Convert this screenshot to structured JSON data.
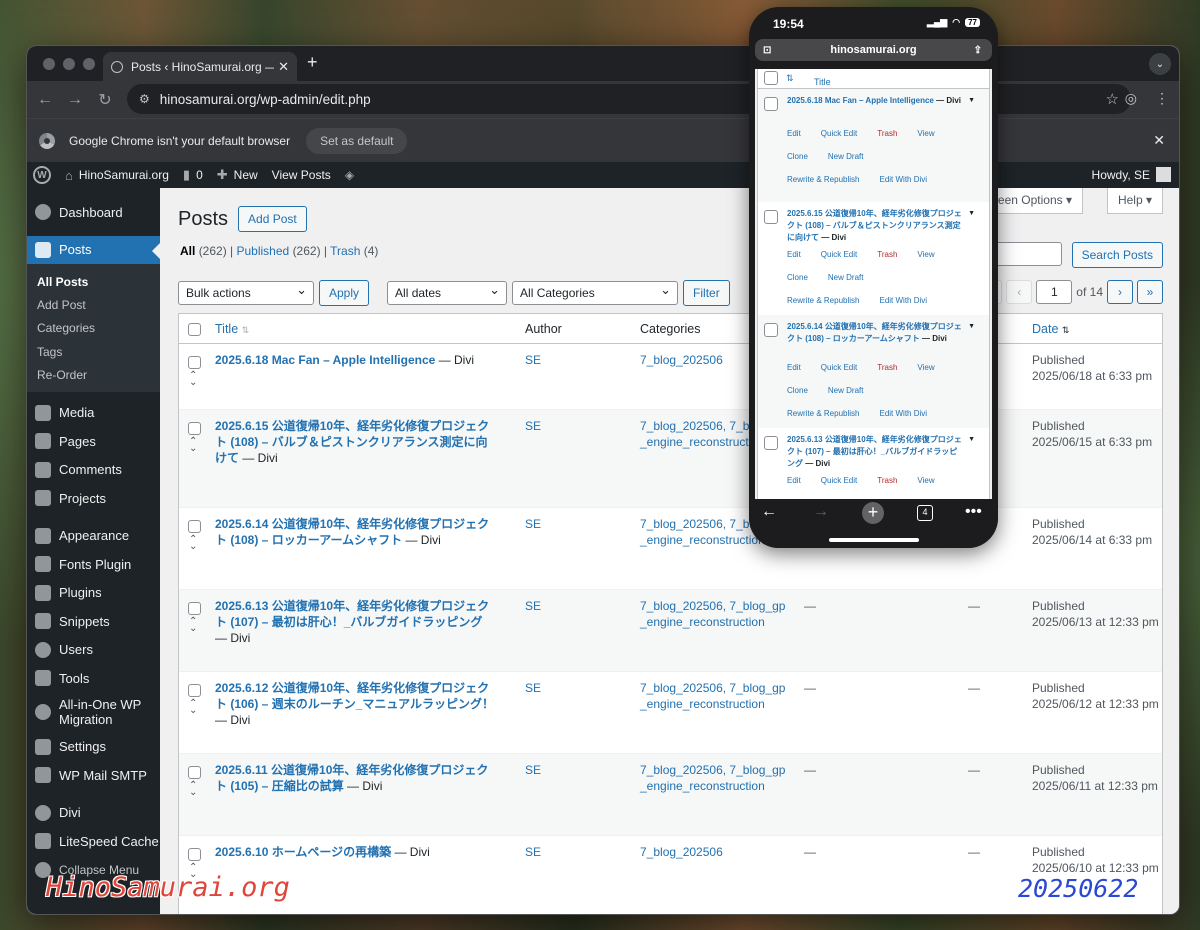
{
  "browser": {
    "tab_title": "Posts ‹ HinoSamurai.org — W",
    "url": "hinosamurai.org/wp-admin/edit.php",
    "infobar_text": "Google Chrome isn't your default browser",
    "set_default_label": "Set as default"
  },
  "adminbar": {
    "site_name": "HinoSamurai.org",
    "comments_count": "0",
    "new_label": "New",
    "view_posts_label": "View Posts",
    "howdy": "Howdy, SE"
  },
  "sidebar": {
    "dashboard": "Dashboard",
    "posts": "Posts",
    "submenu": [
      "All Posts",
      "Add Post",
      "Categories",
      "Tags",
      "Re-Order"
    ],
    "items": [
      "Media",
      "Pages",
      "Comments",
      "Projects",
      "Appearance",
      "Fonts Plugin",
      "Plugins",
      "Snippets",
      "Users",
      "Tools",
      "All-in-One WP Migration",
      "Settings",
      "WP Mail SMTP",
      "Divi",
      "LiteSpeed Cache",
      "Collapse Menu"
    ]
  },
  "page": {
    "title": "Posts",
    "add_post": "Add Post",
    "screen_options": "Screen Options",
    "help": "Help",
    "filters": {
      "all": "All",
      "all_count": "(262)",
      "published": "Published",
      "published_count": "(262)",
      "trash": "Trash",
      "trash_count": "(4)"
    },
    "search_button": "Search Posts",
    "bulk_actions": "Bulk actions",
    "apply": "Apply",
    "all_dates": "All dates",
    "all_categories": "All Categories",
    "filter": "Filter",
    "pagination": {
      "first": "«",
      "prev": "‹",
      "current": "1",
      "of_text": "of 14",
      "next": "›",
      "last": "»"
    }
  },
  "table": {
    "columns": {
      "title": "Title",
      "author": "Author",
      "categories": "Categories",
      "date": "Date"
    },
    "rows": [
      {
        "title": "2025.6.18 Mac Fan – Apple Intelligence",
        "suffix": " — Divi",
        "author": "SE",
        "categories": "7_blog_202506",
        "tags": "",
        "comments": "",
        "status": "Published",
        "date": "2025/06/18 at 6:33 pm"
      },
      {
        "title": "2025.6.15 公道復帰10年、経年劣化修復プロジェクト (108) – バルブ＆ピストンクリアランス測定に向けて",
        "suffix": " — Divi",
        "author": "SE",
        "categories": "7_blog_202506, 7_blog_gp_engine_reconstruction",
        "tags": "",
        "comments": "",
        "status": "Published",
        "date": "2025/06/15 at 6:33 pm"
      },
      {
        "title": "2025.6.14 公道復帰10年、経年劣化修復プロジェクト (108) – ロッカーアームシャフト",
        "suffix": " — Divi",
        "author": "SE",
        "categories": "7_blog_202506, 7_blog_gp_engine_reconstruction",
        "tags": "",
        "comments": "",
        "status": "Published",
        "date": "2025/06/14 at 6:33 pm"
      },
      {
        "title": "2025.6.13 公道復帰10年、経年劣化修復プロジェクト (107) – 最初は肝心！_バルブガイドラッピング",
        "suffix": " — Divi",
        "author": "SE",
        "categories": "7_blog_202506, 7_blog_gp_engine_reconstruction",
        "tags": "—",
        "comments": "—",
        "status": "Published",
        "date": "2025/06/13 at 12:33 pm"
      },
      {
        "title": "2025.6.12 公道復帰10年、経年劣化修復プロジェクト (106) – 週末のルーチン_マニュアルラッピング！",
        "suffix": " — Divi",
        "author": "SE",
        "categories": "7_blog_202506, 7_blog_gp_engine_reconstruction",
        "tags": "—",
        "comments": "—",
        "status": "Published",
        "date": "2025/06/12 at 12:33 pm"
      },
      {
        "title": "2025.6.11 公道復帰10年、経年劣化修復プロジェクト (105) – 圧縮比の試算",
        "suffix": " — Divi",
        "author": "SE",
        "categories": "7_blog_202506, 7_blog_gp_engine_reconstruction",
        "tags": "—",
        "comments": "—",
        "status": "Published",
        "date": "2025/06/11 at 12:33 pm"
      },
      {
        "title": "2025.6.10 ホームページの再構築",
        "suffix": " — Divi",
        "author": "SE",
        "categories": "7_blog_202506",
        "tags": "—",
        "comments": "—",
        "status": "Published",
        "date": "2025/06/10 at 12:33 pm"
      }
    ]
  },
  "phone": {
    "time": "19:54",
    "battery": "77",
    "url": "hinosamurai.org",
    "title_header": "Title",
    "tabs_count": "4",
    "rows": [
      {
        "title": "2025.6.18 Mac Fan – Apple Intelligence",
        "suffix": " — Divi"
      },
      {
        "title": "2025.6.15 公道復帰10年、経年劣化修復プロジェクト (108) – バルブ＆ピストンクリアランス測定に向けて",
        "suffix": " — Divi"
      },
      {
        "title": "2025.6.14 公道復帰10年、経年劣化修復プロジェクト (108) – ロッカーアームシャフト",
        "suffix": " — Divi"
      },
      {
        "title": "2025.6.13 公道復帰10年、経年劣化修復プロジェクト (107) – 最初は肝心！_バルブガイドラッピング",
        "suffix": " — Divi"
      }
    ],
    "actions": {
      "edit": "Edit",
      "quick_edit": "Quick Edit",
      "trash": "Trash",
      "view": "View",
      "clone": "Clone",
      "new_draft": "New Draft",
      "rewrite": "Rewrite & Republish",
      "edit_divi": "Edit With Divi"
    }
  },
  "watermark": {
    "left": "HinoSamurai.org",
    "right": "20250622"
  }
}
